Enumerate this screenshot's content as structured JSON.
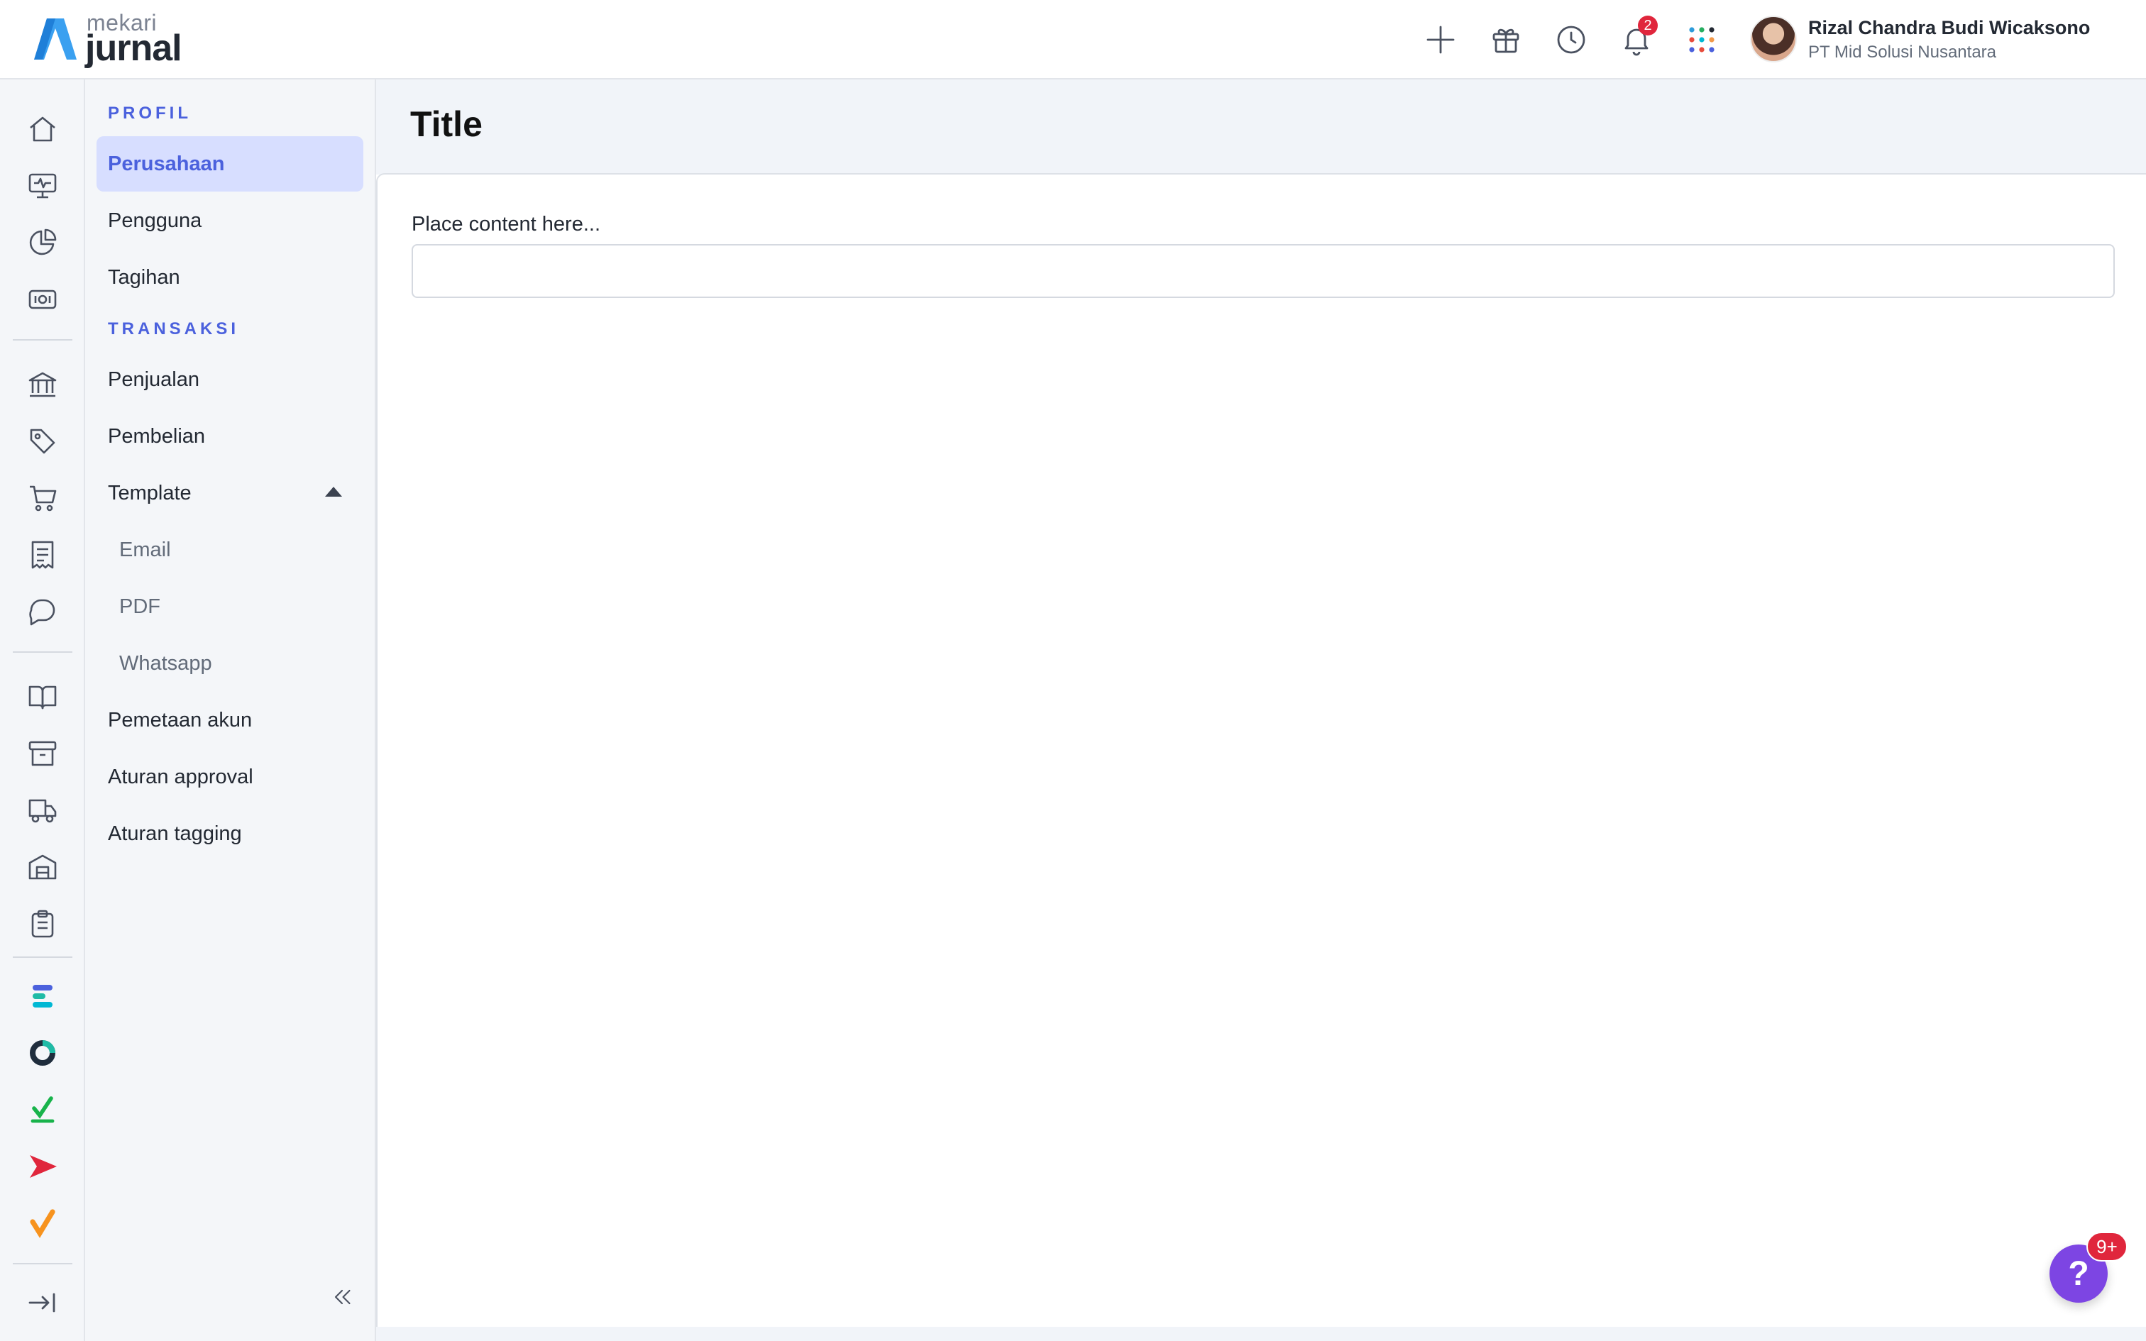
{
  "brand": {
    "product_small": "mekari",
    "product_name": "jurnal",
    "logo_color": "#3aa0f0"
  },
  "topbar": {
    "icons": [
      "plus-icon",
      "gift-icon",
      "clock-icon",
      "bell-icon",
      "apps-grid-icon"
    ],
    "notification_count": "2",
    "user": {
      "name": "Rizal Chandra Budi Wicaksono",
      "company": "PT Mid Solusi Nusantara"
    }
  },
  "rail": {
    "items": [
      "home-icon",
      "monitor-pulse-icon",
      "pie-chart-icon",
      "money-icon",
      "bank-icon",
      "tag-icon",
      "cart-icon",
      "receipt-icon",
      "chat-icon",
      "book-icon",
      "archive-icon",
      "truck-icon",
      "warehouse-icon",
      "clipboard-icon"
    ],
    "apps": [
      "mekari-expense-icon",
      "mekari-flex-icon",
      "mekari-talenta-icon",
      "mekari-qontak-icon",
      "mekari-klikpajak-icon"
    ],
    "expand_icon": "expand-right-icon"
  },
  "sidebar": {
    "section_profil": "PROFIL",
    "section_transaksi": "TRANSAKSI",
    "items": {
      "perusahaan": "Perusahaan",
      "pengguna": "Pengguna",
      "tagihan": "Tagihan",
      "penjualan": "Penjualan",
      "pembelian": "Pembelian",
      "template": "Template",
      "email": "Email",
      "pdf": "PDF",
      "whatsapp": "Whatsapp",
      "pemetaan_akun": "Pemetaan akun",
      "aturan_approval": "Aturan approval",
      "aturan_tagging": "Aturan tagging"
    },
    "active_item": "Perusahaan",
    "accent": "#4b61dd"
  },
  "content": {
    "title": "Title",
    "placeholder_label": "Place content here...",
    "input_value": ""
  },
  "help": {
    "symbol": "?",
    "badge": "9+"
  }
}
